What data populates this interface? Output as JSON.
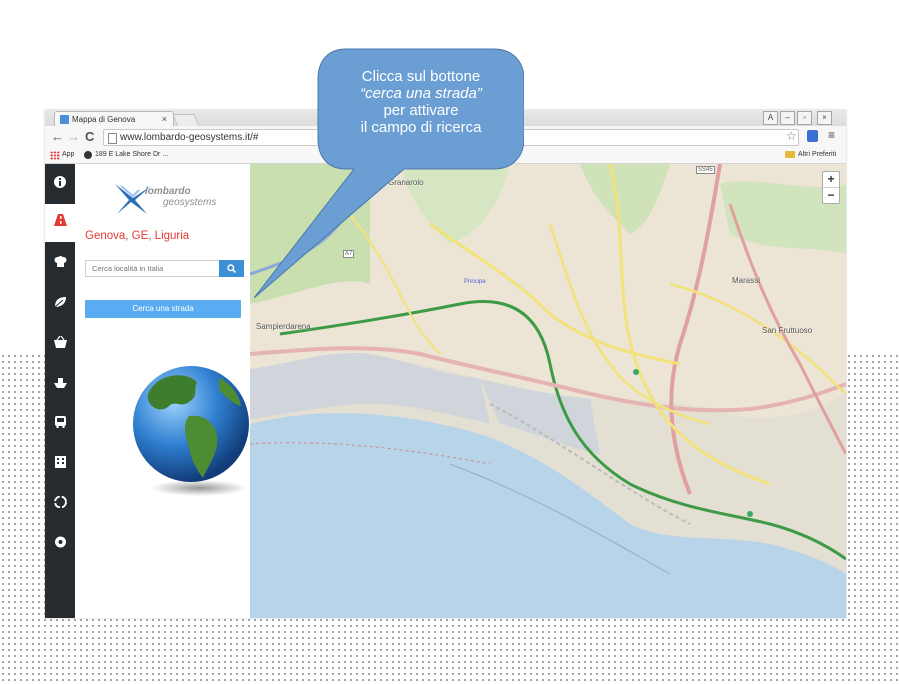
{
  "browser": {
    "tab_title": "Mappa di Genova",
    "tab_close": "×",
    "url": "www.lombardo-geosystems.it/#",
    "bookmarks": {
      "apps_label": "App",
      "item_1": "189 E Lake Shore Dr ...",
      "other_label": "Altri Preferiti"
    },
    "window_controls": [
      "A",
      "–",
      "▫",
      "×"
    ]
  },
  "sidebar": {
    "icons": [
      {
        "name": "info-icon",
        "glyph": "ℹ",
        "active": false
      },
      {
        "name": "road-icon",
        "glyph": "▲",
        "active": true
      },
      {
        "name": "chef-hat-icon",
        "glyph": "☗",
        "active": false
      },
      {
        "name": "leaf-icon",
        "glyph": "❧",
        "active": false
      },
      {
        "name": "basket-icon",
        "glyph": "⊔",
        "active": false
      },
      {
        "name": "ship-icon",
        "glyph": "⛴",
        "active": false
      },
      {
        "name": "bus-icon",
        "glyph": "▣",
        "active": false
      },
      {
        "name": "building-icon",
        "glyph": "▦",
        "active": false
      },
      {
        "name": "recycle-icon",
        "glyph": "♻",
        "active": false
      },
      {
        "name": "settings-icon",
        "glyph": "⚙",
        "active": false
      }
    ]
  },
  "panel": {
    "logo_line1": "lombardo",
    "logo_line2": "geosystems",
    "location": "Genova, GE, Liguria",
    "search_placeholder": "Cerca località in Italia",
    "road_button": "Cerca una strada"
  },
  "map": {
    "zoom_in": "+",
    "zoom_out": "−",
    "labels": {
      "granarolo": "Granarolo",
      "sampierdarena": "Sampierdarena",
      "marassi": "Marassi",
      "san_fruttuoso": "San Fruttuoso",
      "principe": "Principe",
      "road_a7": "A7",
      "road_ss45": "SS45"
    }
  },
  "callout": {
    "line1": "Clicca sul bottone",
    "line2": "“cerca una strada”",
    "line3": "per attivare",
    "line4": "il campo di ricerca"
  },
  "colors": {
    "accent_red": "#e53935",
    "button_blue": "#5aacf2",
    "callout_blue": "#6b9fd4",
    "sidebar_dark": "#262b30"
  }
}
